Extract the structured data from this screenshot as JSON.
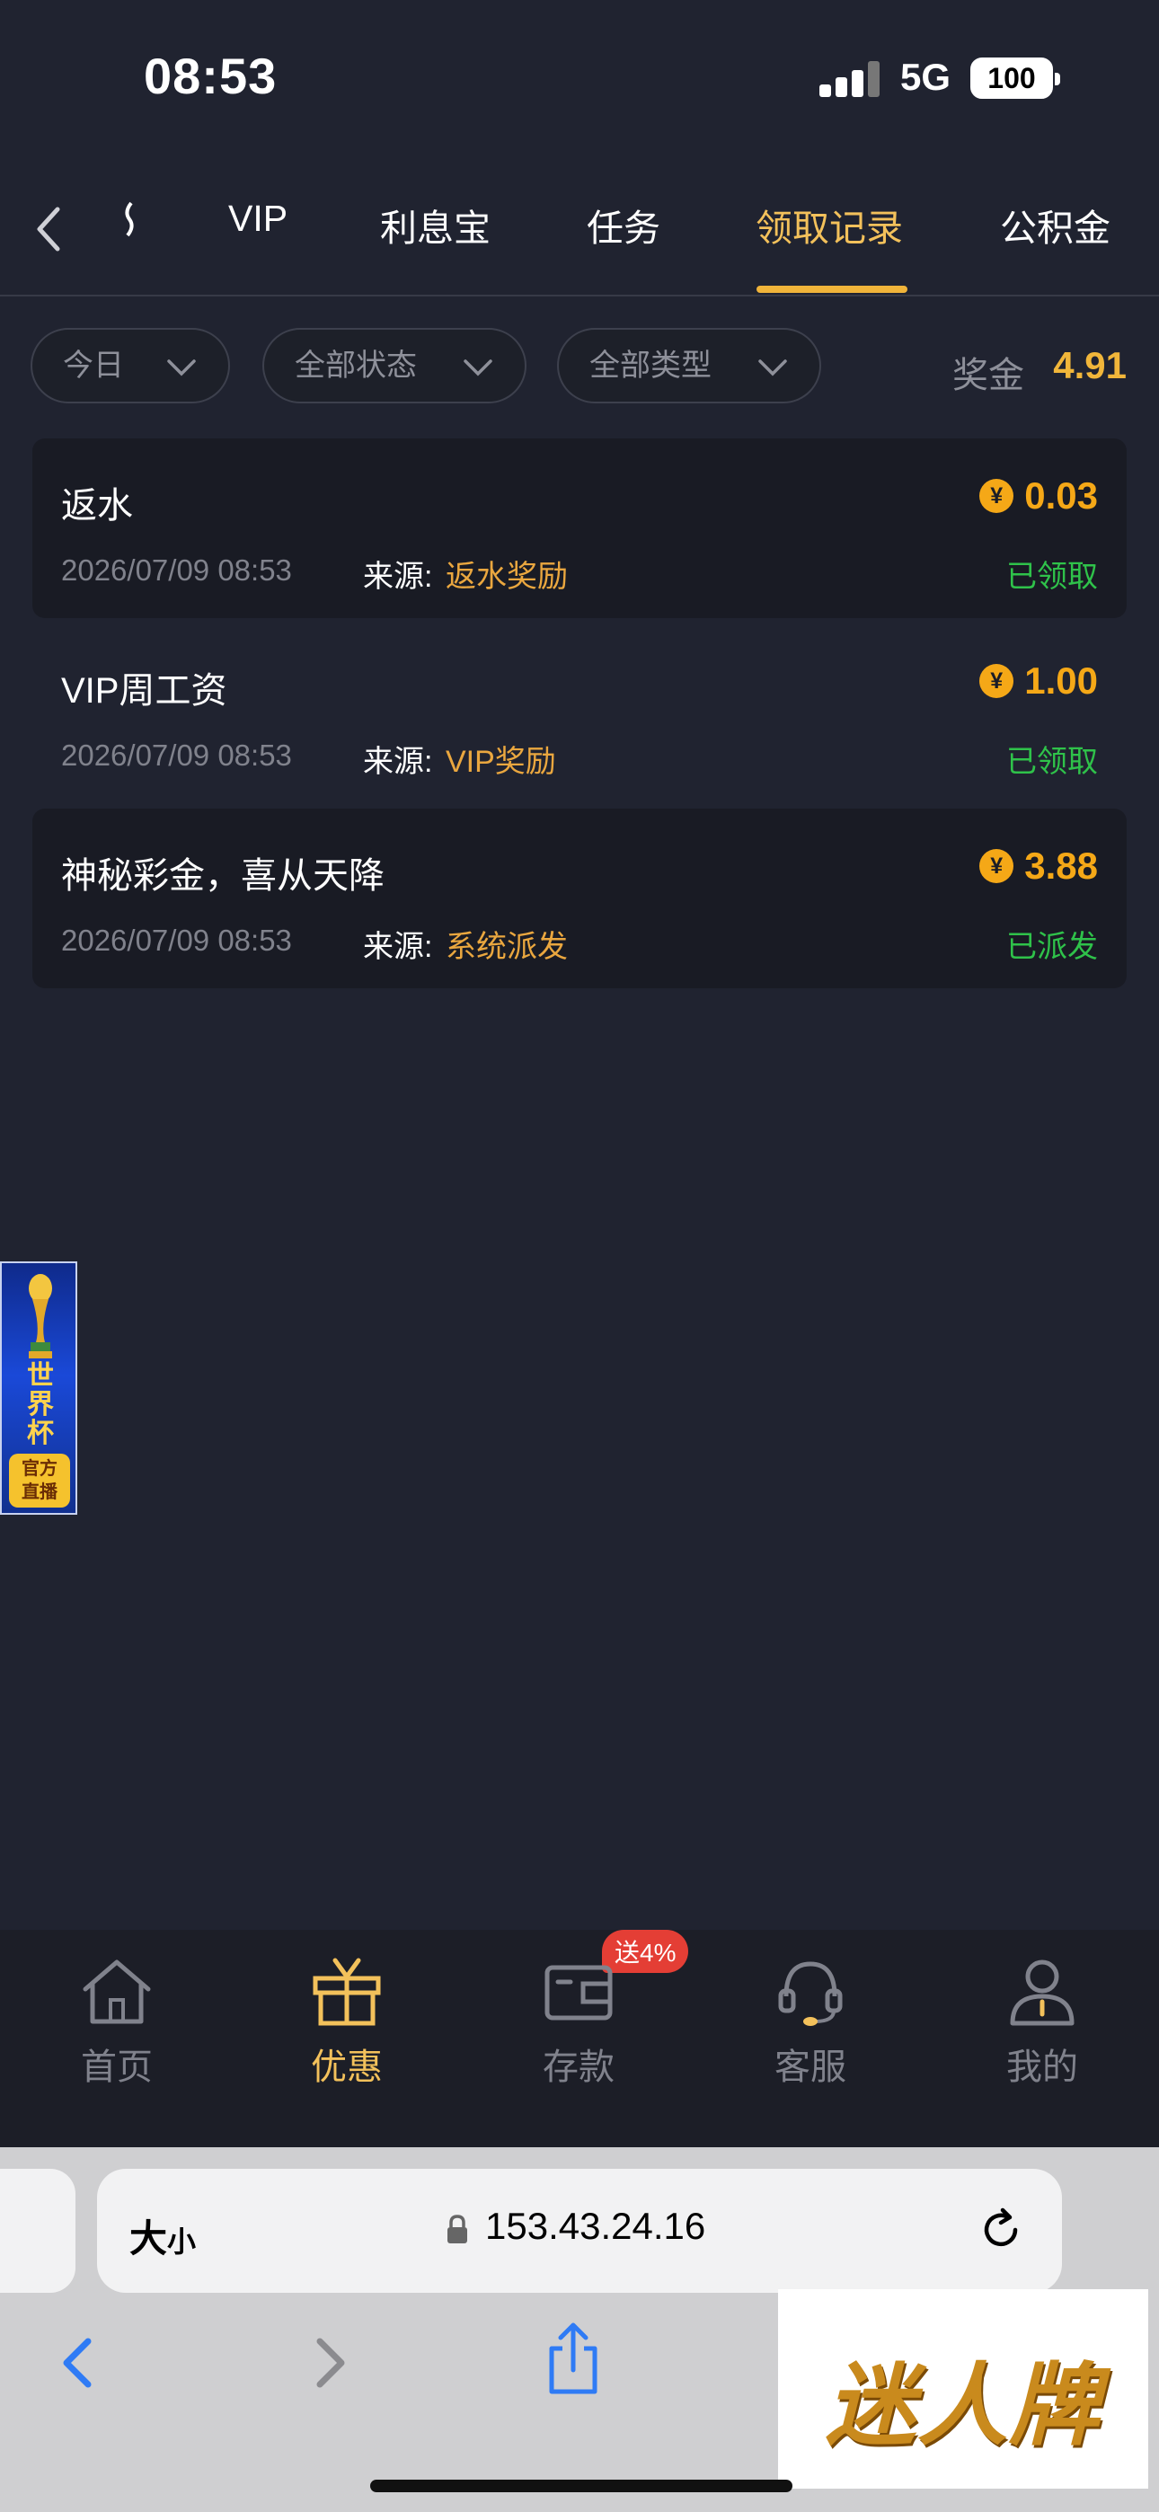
{
  "status_bar": {
    "time": "08:53",
    "network": "5G",
    "battery": "100"
  },
  "tabs": [
    {
      "label": ""
    },
    {
      "label": "VIP"
    },
    {
      "label": "利息宝"
    },
    {
      "label": "任务"
    },
    {
      "label": "领取记录",
      "active": true
    },
    {
      "label": "公积金"
    }
  ],
  "filters": {
    "date": "今日",
    "status": "全部状态",
    "type": "全部类型",
    "bonus_label": "奖金",
    "bonus_value": "4.91"
  },
  "records": [
    {
      "title": "返水",
      "amount": "0.03",
      "time": "2026/07/09 08:53",
      "source_label": "来源:",
      "source": "返水奖励",
      "status": "已领取"
    },
    {
      "title": "VIP周工资",
      "amount": "1.00",
      "time": "2026/07/09 08:53",
      "source_label": "来源:",
      "source": "VIP奖励",
      "status": "已领取"
    },
    {
      "title": "神秘彩金，喜从天降",
      "amount": "3.88",
      "time": "2026/07/09 08:53",
      "source_label": "来源:",
      "source": "系统派发",
      "status": "已派发"
    }
  ],
  "coin_symbol": "¥",
  "world_cup_banner": {
    "title": "世界杯",
    "badge_line1": "官方",
    "badge_line2": "直播"
  },
  "bottom_nav": [
    {
      "label": "首页",
      "icon": "home-icon"
    },
    {
      "label": "优惠",
      "icon": "gift-icon",
      "active": true
    },
    {
      "label": "存款",
      "icon": "wallet-icon",
      "badge": "送4%"
    },
    {
      "label": "客服",
      "icon": "headset-icon"
    },
    {
      "label": "我的",
      "icon": "user-icon"
    }
  ],
  "browser": {
    "text_size_big": "大",
    "text_size_small": "小",
    "url": "153.43.24.16"
  },
  "watermark": "迷人牌",
  "colors": {
    "accent": "#F3C15B",
    "amount": "#F5A817",
    "success": "#2FC24A",
    "background": "#202330"
  }
}
